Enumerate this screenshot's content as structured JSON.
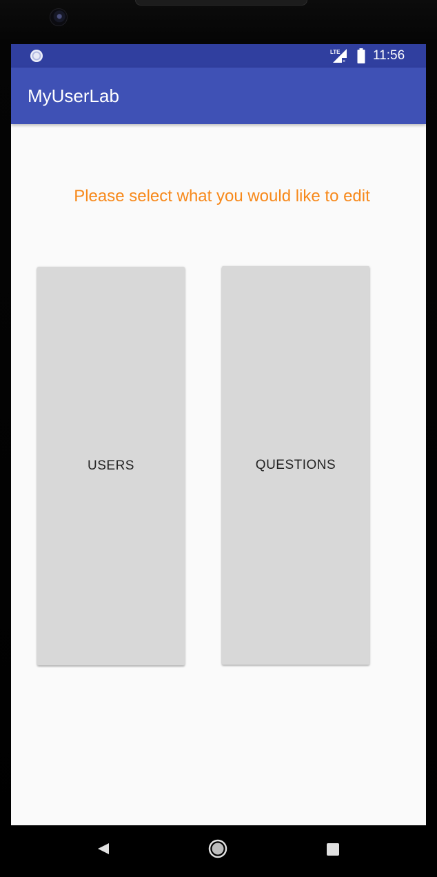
{
  "status_bar": {
    "time": "11:56",
    "network_label": "LTE",
    "icons": [
      "sync-icon",
      "lte-signal-icon",
      "battery-icon"
    ]
  },
  "app_bar": {
    "title": "MyUserLab"
  },
  "main": {
    "prompt": "Please select what you would like to edit",
    "users_button_label": "USERS",
    "questions_button_label": "QUESTIONS"
  },
  "nav_bar": {
    "icons": [
      "back-icon",
      "home-icon",
      "recents-icon"
    ]
  },
  "colors": {
    "status_bar": "#303f9f",
    "app_bar": "#3f51b5",
    "prompt_text": "#f7891b",
    "button_background": "#d8d8d8",
    "screen_background": "#fafafa"
  }
}
